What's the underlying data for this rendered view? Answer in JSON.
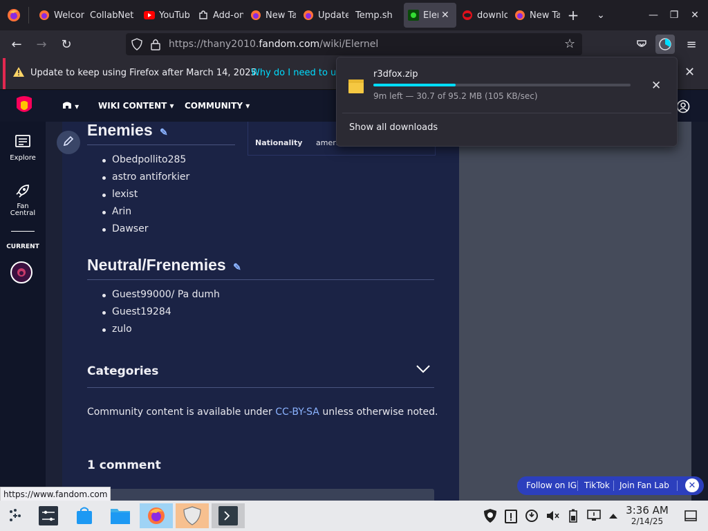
{
  "browser": {
    "tabs": [
      {
        "label": "Welcome",
        "icon": "firefox-icon"
      },
      {
        "label": "CollabNet",
        "icon": "none"
      },
      {
        "label": "YouTube",
        "icon": "youtube-icon"
      },
      {
        "label": "Add-ons",
        "icon": "puzzle-icon"
      },
      {
        "label": "New Tab",
        "icon": "firefox-icon"
      },
      {
        "label": "Update",
        "icon": "firefox-icon"
      },
      {
        "label": "Temp.sh",
        "icon": "none"
      },
      {
        "label": "Elernel",
        "icon": "fandom-icon",
        "active": true
      },
      {
        "label": "download",
        "icon": "opera-icon"
      },
      {
        "label": "New Tab",
        "icon": "firefox-icon"
      }
    ],
    "url_prefix": "https://thany2010.",
    "url_domain": "fandom.com",
    "url_suffix": "/wiki/Elernel",
    "notification_text": "Update to keep using Firefox after March 14, 2025.",
    "notification_link": "Why do I need to up",
    "status_url": "https://www.fandom.com"
  },
  "downloads": {
    "filename": "r3dfox.zip",
    "status": "9m left — 30.7 of 95.2 MB (105 KB/sec)",
    "progress": 0.32,
    "show_all": "Show all downloads"
  },
  "fandom": {
    "nav_wiki_content": "WIKI CONTENT",
    "nav_community": "COMMUNITY",
    "rail_explore": "Explore",
    "rail_fan_central_1": "Fan",
    "rail_fan_central_2": "Central",
    "rail_current": "CURRENT"
  },
  "article": {
    "infobox_label": "Nationality",
    "infobox_value": "america",
    "enemies_heading": "Enemies",
    "enemies": [
      {
        "name": "Obedpollito285",
        "link": true
      },
      {
        "name": "astro antiforkier",
        "link": true
      },
      {
        "name": "lexist",
        "link": true
      },
      {
        "name": "Arin",
        "link": false
      },
      {
        "name": "Dawser",
        "link": true
      }
    ],
    "neutral_heading": "Neutral/Frenemies",
    "neutrals": [
      "Guest99000/ Pa dumh",
      "Guest19284",
      "zulo"
    ],
    "categories_heading": "Categories",
    "license_before": "Community content is available under ",
    "license_link": "CC-BY-SA",
    "license_after": " unless otherwise noted.",
    "comments_heading": "1 comment"
  },
  "social_bar": {
    "ig": "Follow on IG",
    "tiktok": "TikTok",
    "fanlab": "Join Fan Lab"
  },
  "taskbar": {
    "time": "3:36 AM",
    "date": "2/14/25"
  },
  "colors": {
    "accent_blue": "#00ddff",
    "fandom_link": "#8bb3ff",
    "social_bar": "#2c3fbd"
  }
}
